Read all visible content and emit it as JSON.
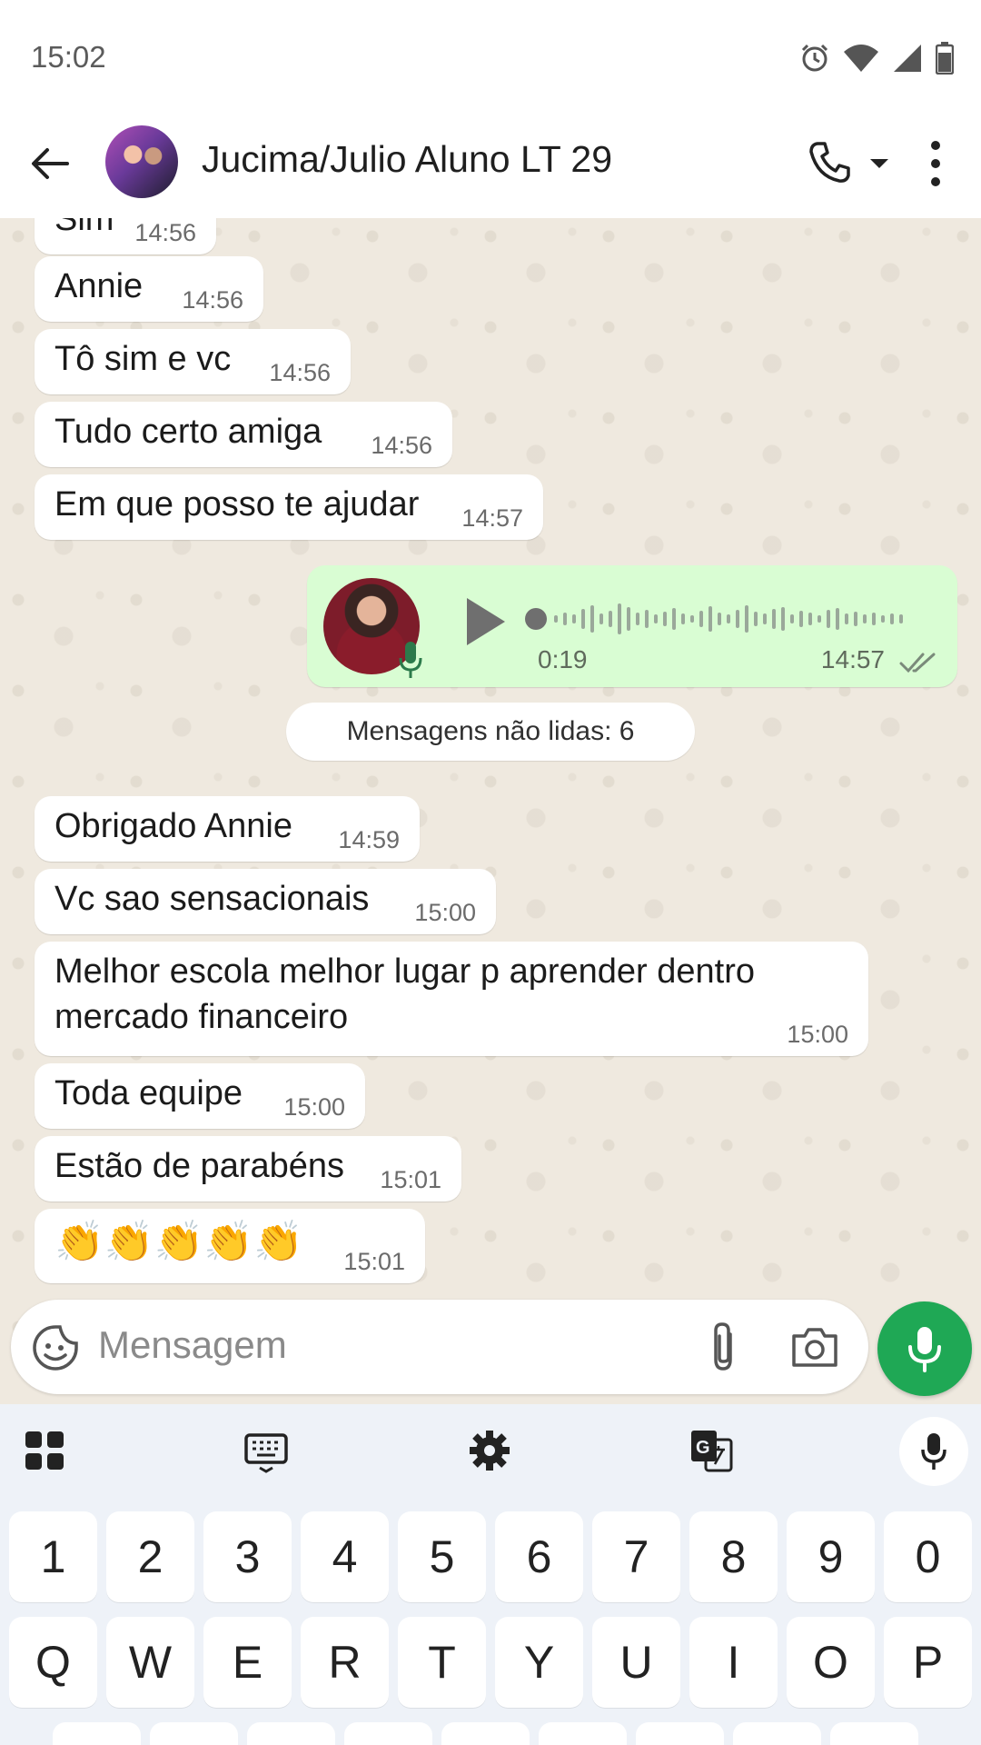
{
  "status": {
    "time": "15:02"
  },
  "header": {
    "title": "Jucima/Julio Aluno LT 29"
  },
  "messages_before": [
    {
      "text": "Sim",
      "time": "14:56"
    },
    {
      "text": "Annie",
      "time": "14:56"
    },
    {
      "text": "Tô sim e vc",
      "time": "14:56"
    },
    {
      "text": "Tudo certo amiga",
      "time": "14:56"
    },
    {
      "text": "Em que posso te ajudar",
      "time": "14:57"
    }
  ],
  "voice": {
    "duration": "0:19",
    "time": "14:57"
  },
  "unread_label": "Mensagens não lidas: 6",
  "messages_after": [
    {
      "text": "Obrigado Annie",
      "time": "14:59"
    },
    {
      "text": "Vc sao sensacionais",
      "time": "15:00"
    },
    {
      "line1": "Melhor escola melhor lugar p aprender dentro",
      "line2": "mercado financeiro",
      "time": "15:00"
    },
    {
      "text": "Toda equipe",
      "time": "15:00"
    },
    {
      "text": "Estão de parabéns",
      "time": "15:01"
    },
    {
      "text": "👏👏👏👏👏",
      "time": "15:01"
    }
  ],
  "composer": {
    "placeholder": "Mensagem"
  },
  "keyboard": {
    "row_numbers": [
      "1",
      "2",
      "3",
      "4",
      "5",
      "6",
      "7",
      "8",
      "9",
      "0"
    ],
    "row_letters": [
      "Q",
      "W",
      "E",
      "R",
      "T",
      "Y",
      "U",
      "I",
      "O",
      "P"
    ]
  },
  "colors": {
    "accent": "#1fa855",
    "outgoing": "#d9fdd3",
    "incoming": "#ffffff",
    "wallpaper": "#efe9df"
  }
}
